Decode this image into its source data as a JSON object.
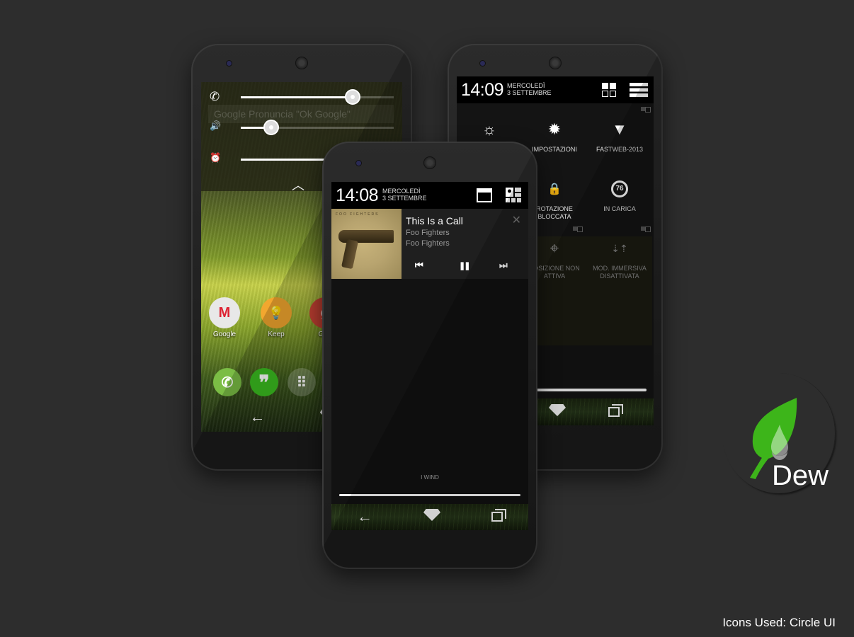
{
  "left_phone": {
    "volume_panel": {
      "rows": [
        {
          "icon": "phone-call-icon",
          "glyph": "✆",
          "level": 0.73
        },
        {
          "icon": "speaker-icon",
          "glyph": "🔊",
          "level": 0.2
        },
        {
          "icon": "alarm-icon",
          "glyph": "⏰",
          "level": 0.9
        }
      ],
      "collapse_glyph": "︿"
    },
    "search_hint": "Google     Pronuncia \"Ok Google\"",
    "apps": [
      {
        "label": "Google",
        "color": "#e0e0e0",
        "glyph": "M"
      },
      {
        "label": "Keep",
        "color": "#f2a72f",
        "glyph": "💡"
      },
      {
        "label": "Goo",
        "color": "#d44638",
        "glyph": "g"
      }
    ],
    "dock": [
      {
        "name": "phone",
        "color": "#7bbd45",
        "glyph": "✆"
      },
      {
        "name": "hangouts",
        "color": "#3bbd20",
        "glyph": "❞"
      },
      {
        "name": "app-drawer",
        "color": "rgba(255,255,255,0.25)",
        "glyph": "⠿"
      }
    ],
    "nav": {
      "back": "←"
    }
  },
  "right_phone": {
    "time": "14:09",
    "day": "MERCOLEDÌ",
    "date": "3 SETTEMBRE",
    "tiles": [
      {
        "label": "",
        "glyph": "☼",
        "icon": "brightness-icon",
        "dim": false
      },
      {
        "label": "IMPOSTAZIONI",
        "glyph": "✹",
        "icon": "settings-icon",
        "dim": false
      },
      {
        "label": "FASTWEB-2013",
        "glyph": "▼",
        "icon": "wifi-icon",
        "dim": false
      },
      {
        "label": "ROTAZIONE BLOCCATA",
        "glyph": "🔒",
        "icon": "rotation-lock-icon",
        "dim": false
      },
      {
        "label": "IN CARICA",
        "glyph": "76",
        "icon": "battery-icon",
        "dim": false
      },
      {
        "label": "POSIZIONE NON ATTIVA",
        "glyph": "⌖",
        "icon": "location-icon",
        "dim": true
      },
      {
        "label": "MOD. IMMERSIVA DISATTIVATA",
        "glyph": "⇣⇡",
        "icon": "immersive-mode-icon",
        "dim": true
      }
    ]
  },
  "center_phone": {
    "time": "14:08",
    "day": "MERCOLEDÌ",
    "date": "3 SETTEMBRE",
    "media": {
      "album_band": "FOO FIGHTERS",
      "title": "This Is a Call",
      "artist": "Foo Fighters",
      "album": "Foo Fighters",
      "close_glyph": "✕",
      "prev_glyph": "⏮",
      "pause_glyph": "❚❚",
      "next_glyph": "⏭"
    },
    "carrier": "I WIND",
    "nav": {
      "back": "←"
    }
  },
  "branding": {
    "app_name": "Dew",
    "credits": "Icons Used: Circle UI",
    "leaf_color": "#3db51a"
  }
}
